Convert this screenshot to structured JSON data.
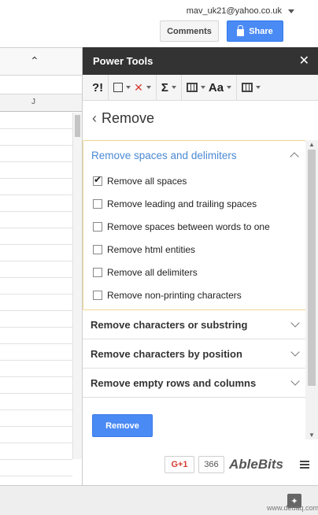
{
  "header": {
    "account": "mav_uk21@yahoo.co.uk",
    "comments_label": "Comments",
    "share_label": "Share"
  },
  "sheet": {
    "column_letter": "J"
  },
  "panel": {
    "title": "Power Tools",
    "close_glyph": "✕",
    "back_title": "Remove",
    "toolbar": {
      "sum_glyph": "Σ",
      "case_glyph": "Aa",
      "find_glyph": "?!"
    },
    "open_section": {
      "title": "Remove spaces and delimiters",
      "options": [
        {
          "label": "Remove all spaces",
          "checked": true
        },
        {
          "label": "Remove leading and trailing spaces",
          "checked": false
        },
        {
          "label": "Remove spaces between words to one",
          "checked": false
        },
        {
          "label": "Remove html entities",
          "checked": false
        },
        {
          "label": "Remove all delimiters",
          "checked": false
        },
        {
          "label": "Remove non-printing characters",
          "checked": false
        }
      ]
    },
    "closed_sections": [
      "Remove characters or substring",
      "Remove characters by position",
      "Remove empty rows and columns"
    ],
    "remove_button": "Remove",
    "footer": {
      "gplus_label": "G+1",
      "gplus_count": "366",
      "brand": "AbleBits"
    }
  },
  "watermark": "www.deuaq.com",
  "colors": {
    "accent_blue": "#4a8af4",
    "panel_header": "#333333",
    "open_section_border": "#f0d890",
    "open_section_title": "#4a8ad4"
  }
}
